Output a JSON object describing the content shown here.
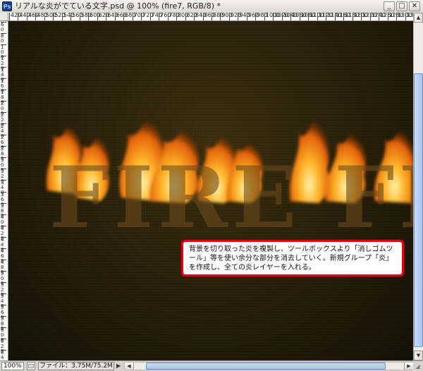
{
  "window": {
    "title": "リアルな炎がでている文字.psd @ 100% (fire7, RGB/8) *",
    "app_icon_label": "Ps",
    "buttons": {
      "minimize": "_",
      "maximize": "□",
      "close": "✕"
    }
  },
  "ruler": {
    "top_labels": [
      "420",
      "440",
      "460",
      "480",
      "500",
      "520",
      "540",
      "560",
      "580",
      "600",
      "620",
      "640",
      "660",
      "680",
      "700",
      "720",
      "740",
      "760",
      "780",
      "800",
      "820",
      "840",
      "860",
      "880",
      "900",
      "920",
      "940",
      "960",
      "980",
      "1000",
      "1020",
      "1040",
      "1060",
      "1080",
      "1100",
      "1120",
      "1140",
      "1160",
      "1180",
      "1200",
      "1220",
      "1240",
      "1260",
      "1280",
      "1300",
      "1320"
    ],
    "left_labels": [
      "60",
      "80",
      "100",
      "120",
      "140",
      "160",
      "180",
      "200",
      "220",
      "240",
      "260",
      "280",
      "300",
      "320",
      "340",
      "360",
      "380",
      "400",
      "420",
      "440",
      "460",
      "480",
      "500",
      "520",
      "540",
      "560",
      "580",
      "600",
      "620",
      "640"
    ]
  },
  "canvas": {
    "text": "FIRE FIRE",
    "colors": {
      "background": "#2a210b",
      "text": "#6a4a1a",
      "flame_outer": "#e05a08",
      "flame_mid": "#ff9a1a",
      "flame_core": "#ffe27a"
    }
  },
  "callout": {
    "text": "背景を切り取った炎を複製し、ツールボックスより「消しゴムツール」等を使い余分な部分を消去していく。新規グループ「炎」を作成し、全ての炎レイヤーを入れる。",
    "border_color": "#e60012"
  },
  "statusbar": {
    "zoom": "100%",
    "file_info": "ファイル：3.75M/75.2M",
    "arrow": "▶"
  },
  "scrollbars": {
    "up": "▲",
    "down": "▼",
    "left": "◀",
    "right": "▶"
  }
}
